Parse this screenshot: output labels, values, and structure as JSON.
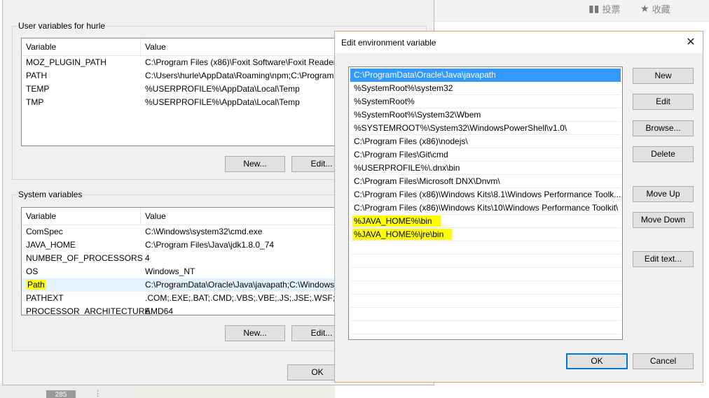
{
  "background_page": {
    "vote_label": "投票",
    "collect_label": "收藏",
    "counter": "285"
  },
  "env_dialog": {
    "user_vars": {
      "title": "User variables for hurle",
      "col_variable": "Variable",
      "col_value": "Value",
      "rows": [
        {
          "name": "MOZ_PLUGIN_PATH",
          "value": "C:\\Program Files (x86)\\Foxit Software\\Foxit Reader\\p"
        },
        {
          "name": "PATH",
          "value": "C:\\Users\\hurle\\AppData\\Roaming\\npm;C:\\Program"
        },
        {
          "name": "TEMP",
          "value": "%USERPROFILE%\\AppData\\Local\\Temp"
        },
        {
          "name": "TMP",
          "value": "%USERPROFILE%\\AppData\\Local\\Temp"
        }
      ],
      "new_label": "New...",
      "edit_label": "Edit..."
    },
    "system_vars": {
      "title": "System variables",
      "col_variable": "Variable",
      "col_value": "Value",
      "rows": [
        {
          "name": "ComSpec",
          "value": "C:\\Windows\\system32\\cmd.exe"
        },
        {
          "name": "JAVA_HOME",
          "value": "C:\\Program Files\\Java\\jdk1.8.0_74"
        },
        {
          "name": "NUMBER_OF_PROCESSORS",
          "value": "4"
        },
        {
          "name": "OS",
          "value": "Windows_NT"
        },
        {
          "name": "Path",
          "value": "C:\\ProgramData\\Oracle\\Java\\javapath;C:\\Windows\\"
        },
        {
          "name": "PATHEXT",
          "value": ".COM;.EXE;.BAT;.CMD;.VBS;.VBE;.JS;.JSE;.WSF;.WSH;."
        },
        {
          "name": "PROCESSOR_ARCHITECTURE",
          "value": "AMD64"
        }
      ],
      "new_label": "New...",
      "edit_label": "Edit..."
    },
    "ok_label": "OK"
  },
  "edit_dialog": {
    "title": "Edit environment variable",
    "close_glyph": "✕",
    "entries": [
      "C:\\ProgramData\\Oracle\\Java\\javapath",
      "%SystemRoot%\\system32",
      "%SystemRoot%",
      "%SystemRoot%\\System32\\Wbem",
      "%SYSTEMROOT%\\System32\\WindowsPowerShell\\v1.0\\",
      "C:\\Program Files (x86)\\nodejs\\",
      "C:\\Program Files\\Git\\cmd",
      "%USERPROFILE%\\.dnx\\bin",
      "C:\\Program Files\\Microsoft DNX\\Dnvm\\",
      "C:\\Program Files (x86)\\Windows Kits\\8.1\\Windows Performance Toolk...",
      "C:\\Program Files (x86)\\Windows Kits\\10\\Windows Performance Toolkit\\",
      "%JAVA_HOME%\\bin",
      "%JAVA_HOME%\\jre\\bin"
    ],
    "buttons": {
      "new": "New",
      "edit": "Edit",
      "browse": "Browse...",
      "delete": "Delete",
      "move_up": "Move Up",
      "move_down": "Move Down",
      "edit_text": "Edit text...",
      "ok": "OK",
      "cancel": "Cancel"
    },
    "colors": {
      "selection": "#3399ff",
      "highlight": "#ffff00",
      "border_accent": "#e8a162",
      "default_button": "#0078d7"
    }
  }
}
